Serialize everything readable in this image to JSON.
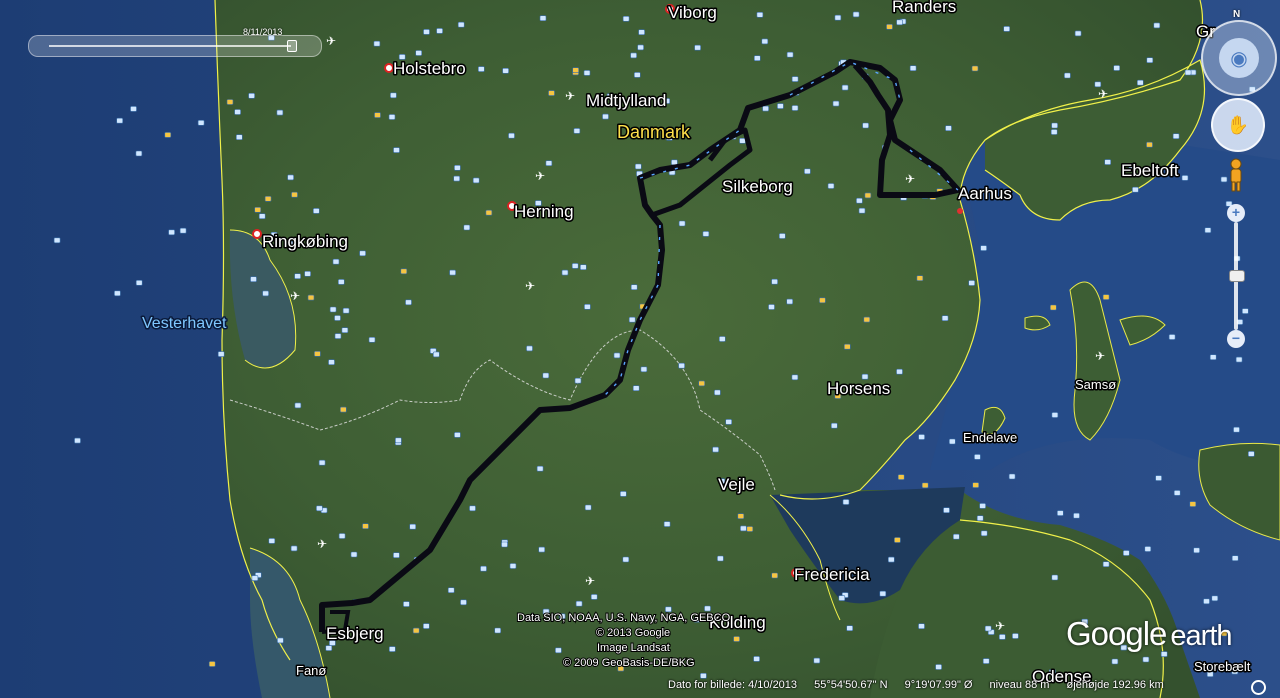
{
  "time_slider": {
    "date": "8/11/2013"
  },
  "nav": {
    "north_label": "N",
    "zoom_in": "+",
    "zoom_out": "−"
  },
  "labels": {
    "viborg": "Viborg",
    "randers": "Randers",
    "holstebro": "Holstebro",
    "midtjylland": "Midtjylland",
    "danmark": "Danmark",
    "silkeborg": "Silkeborg",
    "aarhus": "Aarhus",
    "ebeltoft": "Ebeltoft",
    "herning": "Herning",
    "ringkobing": "Ringkøbing",
    "vesterhavet": "Vesterhavet",
    "horsens": "Horsens",
    "samso": "Samsø",
    "endelave": "Endelave",
    "vejle": "Vejle",
    "kolding": "Kolding",
    "fredericia": "Fredericia",
    "esbjerg": "Esbjerg",
    "fano": "Fanø",
    "odense": "Odense",
    "storebaelt": "Storebælt",
    "gr": "Gr"
  },
  "credits": {
    "line1": "Data SIO, NOAA, U.S. Navy, NGA, GEBCO",
    "line2": "© 2013 Google",
    "line3": "Image Landsat",
    "line4": "© 2009 GeoBasis-DE/BKG"
  },
  "logo": {
    "google": "Google",
    "earth": "earth"
  },
  "status": {
    "imagery_date": "Dato for billede: 4/10/2013",
    "lat": "55°54'50.67\" N",
    "lon": "9°19'07.99\" Ø",
    "elevation": "niveau   88 m",
    "eye_alt": "øjehøjde 192.96 km"
  },
  "colors": {
    "route": "#0a0a14",
    "route_highlight": "#5aa6ff",
    "border": "#f0f04a",
    "land": "#3a5a32",
    "sea": "#24447a"
  }
}
